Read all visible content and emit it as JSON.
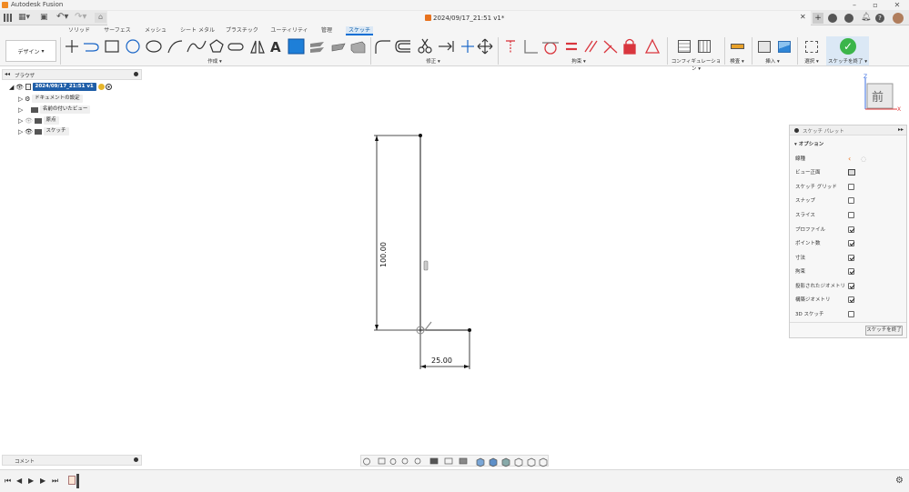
{
  "app": {
    "title": "Autodesk Fusion"
  },
  "document": {
    "title": "2024/09/17_21:51 v1*"
  },
  "workspace_tabs": [
    "ソリッド",
    "サーフェス",
    "メッシュ",
    "シート メタル",
    "プラスチック",
    "ユーティリティ",
    "管理",
    "スケッチ"
  ],
  "active_tab": "スケッチ",
  "toolbar": {
    "design_label": "デザイン",
    "groups": {
      "create": "作成",
      "modify": "修正",
      "constraints": "拘束",
      "configure": "コンフィギュレーション",
      "inspect": "検査",
      "insert": "挿入",
      "select": "選択",
      "finish": "スケッチを終了"
    }
  },
  "browser": {
    "title": "ブラウザ",
    "root": "2024/09/17_21:51 v1",
    "items": [
      "ドキュメントの設定",
      "名前の付いたビュー",
      "原点",
      "スケッチ"
    ]
  },
  "comments": {
    "title": "コメント"
  },
  "viewcube": {
    "face": "前",
    "axis_z": "Z",
    "axis_x": "X"
  },
  "palette": {
    "title": "スケッチ パレット",
    "section": "オプション",
    "options": [
      {
        "label": "線種",
        "type": "icons"
      },
      {
        "label": "ビュー正面",
        "type": "icon"
      },
      {
        "label": "スケッチ グリッド",
        "checked": false
      },
      {
        "label": "スナップ",
        "checked": false
      },
      {
        "label": "スライス",
        "checked": false
      },
      {
        "label": "プロファイル",
        "checked": true
      },
      {
        "label": "ポイント数",
        "checked": true
      },
      {
        "label": "寸法",
        "checked": true
      },
      {
        "label": "拘束",
        "checked": true
      },
      {
        "label": "投影されたジオメトリ",
        "checked": true
      },
      {
        "label": "構築ジオメトリ",
        "checked": true
      },
      {
        "label": "3D スケッチ",
        "checked": false
      }
    ],
    "finish_button": "スケッチを終了"
  },
  "sketch": {
    "dim_vertical": "100.00",
    "dim_horizontal": "25.00"
  },
  "colors": {
    "accent": "#0a6fd4",
    "finish_green": "#3bb54a",
    "constraint_red": "#d9363e"
  }
}
